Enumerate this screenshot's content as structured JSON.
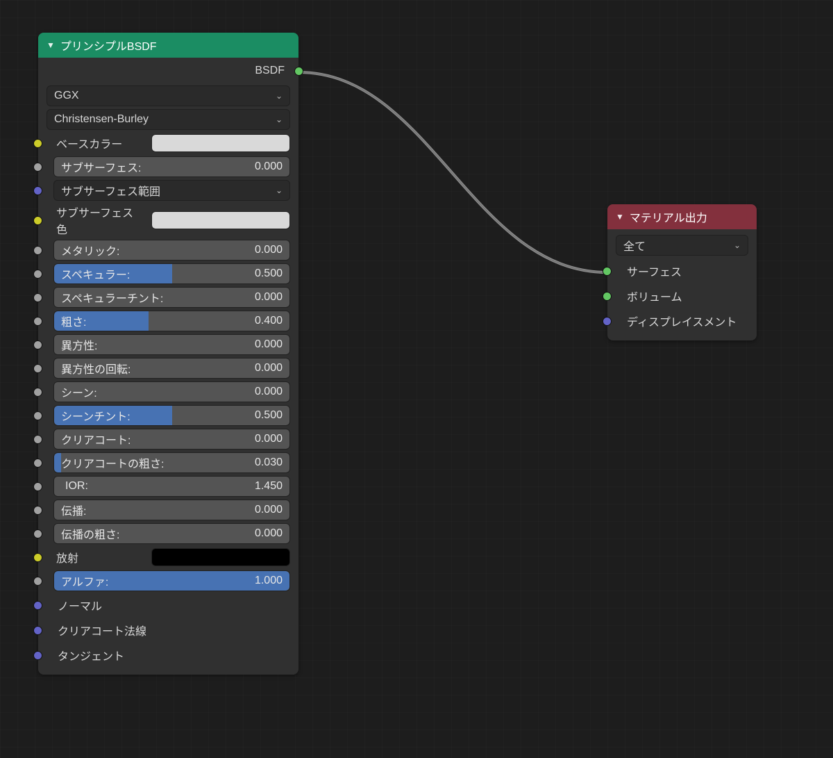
{
  "bsdf": {
    "title": "プリンシプルBSDF",
    "output_label": "BSDF",
    "distribution": "GGX",
    "subsurface_method": "Christensen-Burley",
    "base_color_label": "ベースカラー",
    "base_color_value": "#d9d9d9",
    "subsurface": {
      "label": "サブサーフェス:",
      "value": "0.000",
      "fill": 0
    },
    "subsurface_radius_label": "サブサーフェス範囲",
    "subsurface_color_label": "サブサーフェス色",
    "subsurface_color_value": "#d9d9d9",
    "metallic": {
      "label": "メタリック:",
      "value": "0.000",
      "fill": 0
    },
    "specular": {
      "label": "スペキュラー:",
      "value": "0.500",
      "fill": 0.5
    },
    "specular_tint": {
      "label": "スペキュラーチント:",
      "value": "0.000",
      "fill": 0
    },
    "roughness": {
      "label": "粗さ:",
      "value": "0.400",
      "fill": 0.4
    },
    "anisotropic": {
      "label": "異方性:",
      "value": "0.000",
      "fill": 0
    },
    "anisotropic_rotation": {
      "label": "異方性の回転:",
      "value": "0.000",
      "fill": 0
    },
    "sheen": {
      "label": "シーン:",
      "value": "0.000",
      "fill": 0
    },
    "sheen_tint": {
      "label": "シーンチント:",
      "value": "0.500",
      "fill": 0.5
    },
    "clearcoat": {
      "label": "クリアコート:",
      "value": "0.000",
      "fill": 0
    },
    "clearcoat_roughness": {
      "label": "クリアコートの粗さ:",
      "value": "0.030",
      "fill": 0.03
    },
    "ior": {
      "label": "IOR:",
      "value": "1.450"
    },
    "transmission": {
      "label": "伝播:",
      "value": "0.000",
      "fill": 0
    },
    "transmission_roughness": {
      "label": "伝播の粗さ:",
      "value": "0.000",
      "fill": 0
    },
    "emission_label": "放射",
    "emission_value": "#000000",
    "alpha": {
      "label": "アルファ:",
      "value": "1.000",
      "fill": 1
    },
    "normal_label": "ノーマル",
    "clearcoat_normal_label": "クリアコート法線",
    "tangent_label": "タンジェント"
  },
  "output": {
    "title": "マテリアル出力",
    "target": "全て",
    "surface": "サーフェス",
    "volume": "ボリューム",
    "displacement": "ディスプレイスメント"
  }
}
